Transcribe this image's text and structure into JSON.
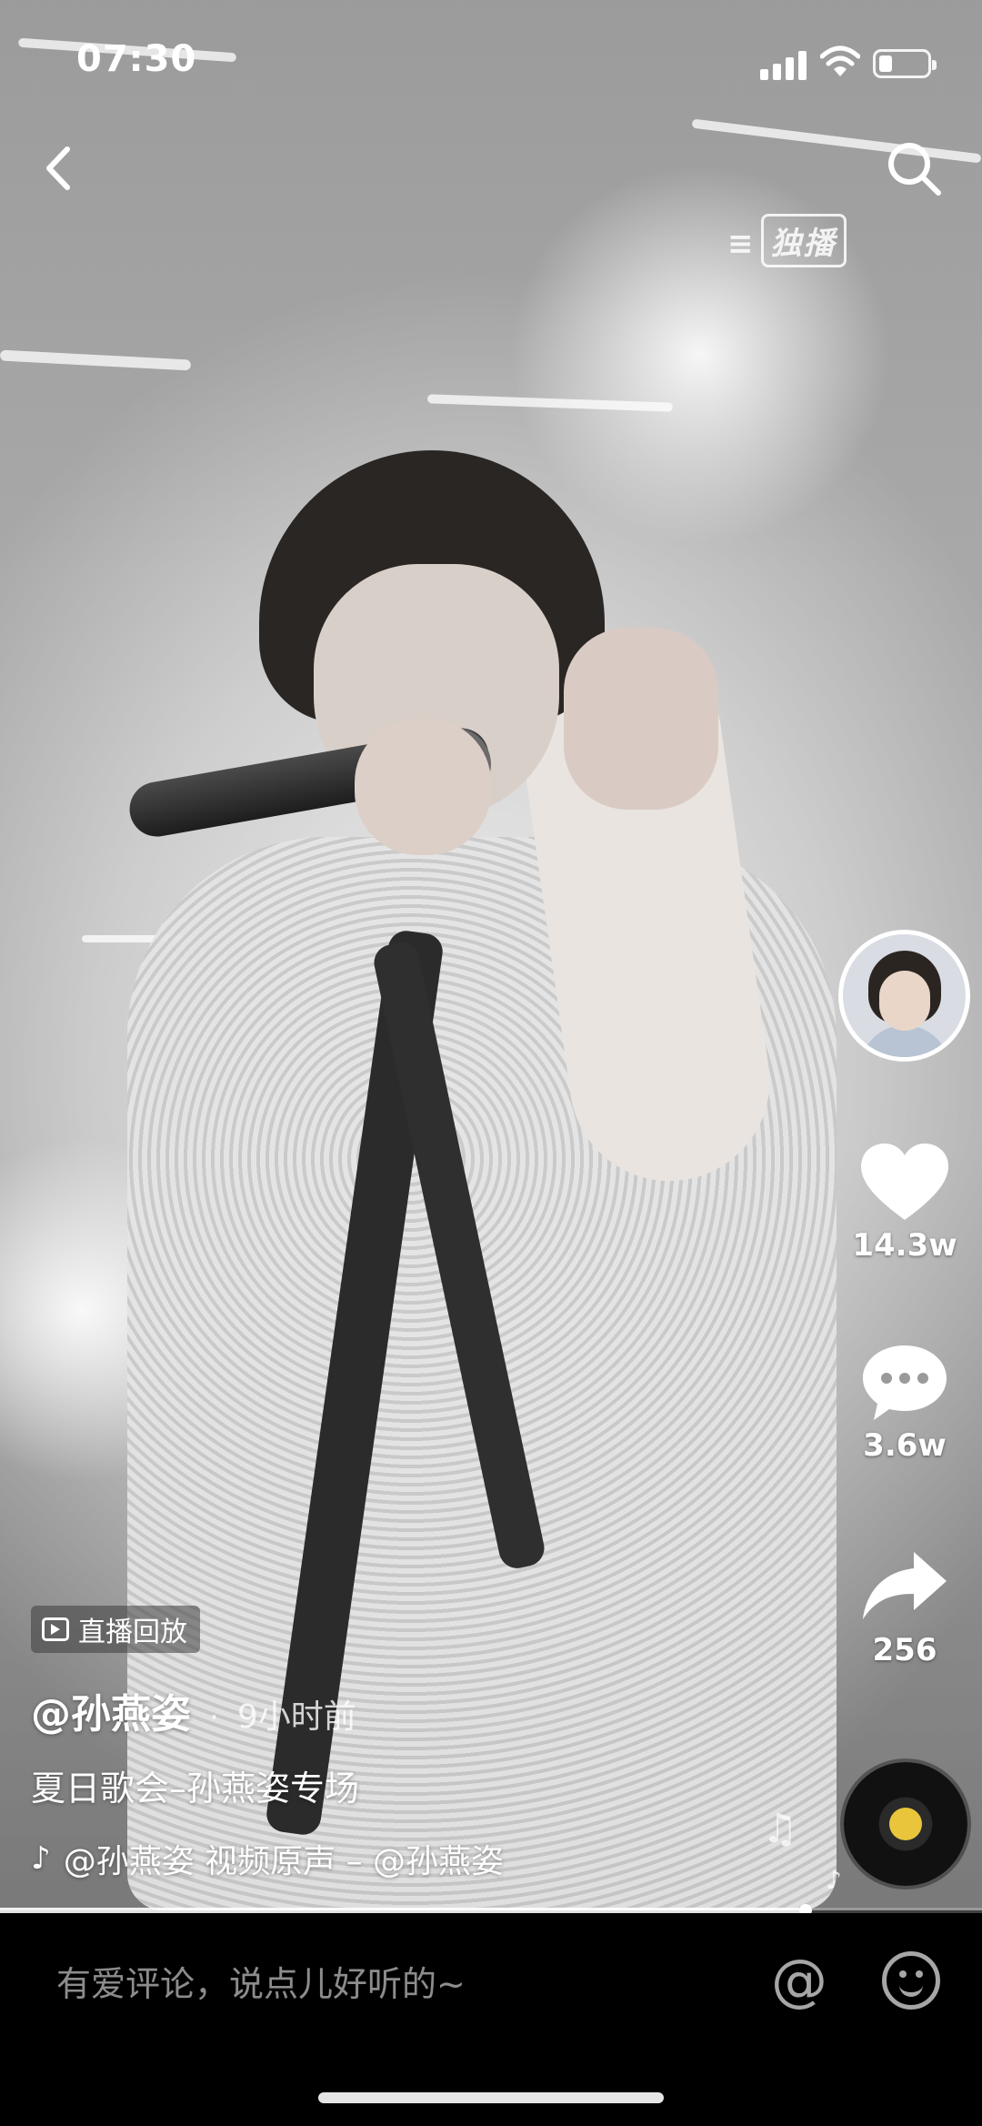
{
  "status_bar": {
    "time": "07:30"
  },
  "video": {
    "watermark": "独播",
    "live_replay_badge": "直播回放",
    "author": "@孙燕姿",
    "posted_ago": "9小时前",
    "description": "夏日歌会–孙燕姿专场",
    "music_track": "@孙燕姿    视频原声 – @孙燕姿",
    "progress": 0.82
  },
  "actions": {
    "likes": "14.3w",
    "comments": "3.6w",
    "shares": "256"
  },
  "comment_bar": {
    "placeholder": "有爱评论，说点儿好听的~"
  },
  "icons": [
    "back-icon",
    "search-icon",
    "heart-icon",
    "comment-icon",
    "share-icon",
    "music-disc-icon",
    "at-icon",
    "emoji-icon",
    "tiktok-note-icon",
    "play-icon"
  ]
}
